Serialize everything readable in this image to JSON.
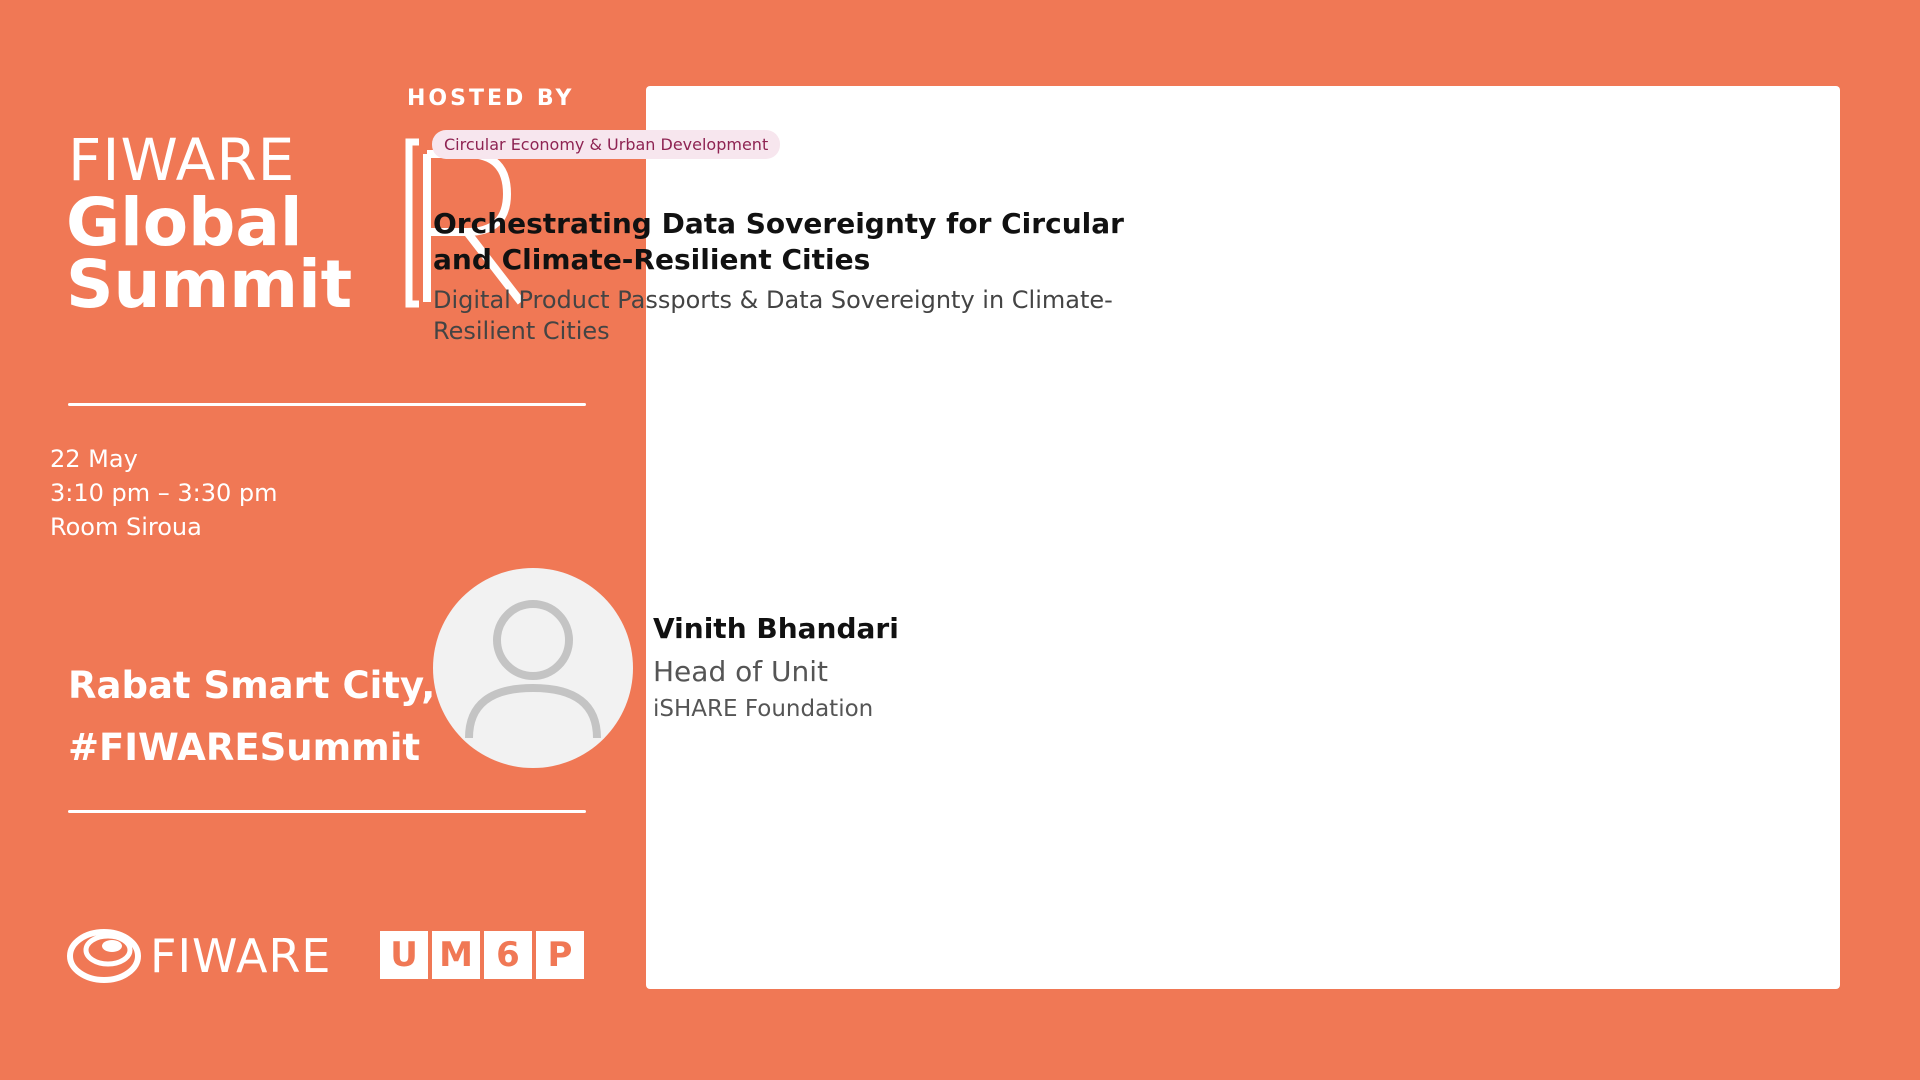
{
  "branding": {
    "hosted_by": "HOSTED BY",
    "title_line1": "FIWARE",
    "title_line2": "Global",
    "title_line3": "Summit",
    "fiware_logo_text": "FIWARE",
    "um6p_letters": [
      "U",
      "M",
      "6",
      "P"
    ],
    "location": "Rabat Smart City, Morocco",
    "hashtag": "#FIWARESummit"
  },
  "event": {
    "date": "22 May",
    "time": "3:10 pm – 3:30 pm",
    "room": "Room Siroua"
  },
  "session": {
    "category": "Circular Economy & Urban Development",
    "title": "Orchestrating Data Sovereignty for Circular and Climate-Resilient Cities",
    "subtitle": "Digital Product Passports & Data Sovereignty in Climate-Resilient Cities"
  },
  "speaker": {
    "avatar_icon": "user-placeholder-icon",
    "name": "Vinith Bhandari",
    "role": "Head of Unit",
    "organization": "iSHARE Foundation"
  },
  "colors": {
    "background": "#F07855",
    "card": "#FFFFFF",
    "badge_bg": "#F7E6EE",
    "badge_text": "#8E2352"
  }
}
